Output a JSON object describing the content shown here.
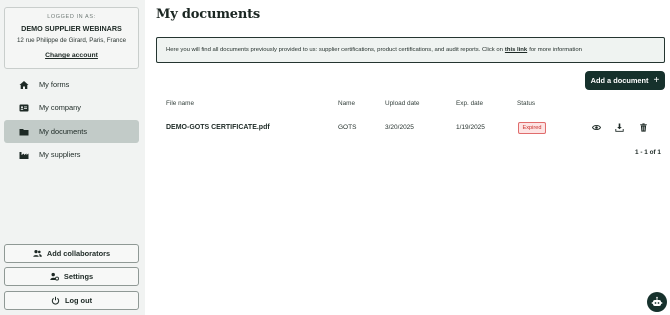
{
  "account": {
    "logged_in_label": "LOGGED IN AS:",
    "company_name": "DEMO SUPPLIER WEBINARS",
    "address": "12 rue Philippe de Girard, Paris, France",
    "change_account": "Change account"
  },
  "nav": {
    "items": [
      {
        "label": "My forms",
        "icon": "home-icon"
      },
      {
        "label": "My company",
        "icon": "id-card-icon"
      },
      {
        "label": "My documents",
        "icon": "folder-icon",
        "active": true
      },
      {
        "label": "My suppliers",
        "icon": "factory-icon"
      }
    ]
  },
  "sidebar_actions": {
    "add_collaborators": "Add collaborators",
    "settings": "Settings",
    "logout": "Log out"
  },
  "page": {
    "title": "My documents",
    "info_before": "Here you will find all documents previously provided to us: supplier certifications, product certifications, and audit reports. Click on",
    "info_link": "this link",
    "info_after": "for more information",
    "add_button": "Add a document",
    "add_plus": "+"
  },
  "table": {
    "headers": [
      "File name",
      "Name",
      "Upload date",
      "Exp. date",
      "Status"
    ],
    "rows": [
      {
        "file_name": "DEMO-GOTS CERTIFICATE.pdf",
        "name": "GOTS",
        "upload_date": "3/20/2025",
        "exp_date": "1/19/2025",
        "status": "Expired"
      }
    ],
    "pagination": "1 - 1 of 1"
  },
  "colors": {
    "accent": "#16312c",
    "active_nav": "#c2cbc8",
    "expired_text": "#c9302c",
    "expired_bg": "#fde4e4"
  }
}
